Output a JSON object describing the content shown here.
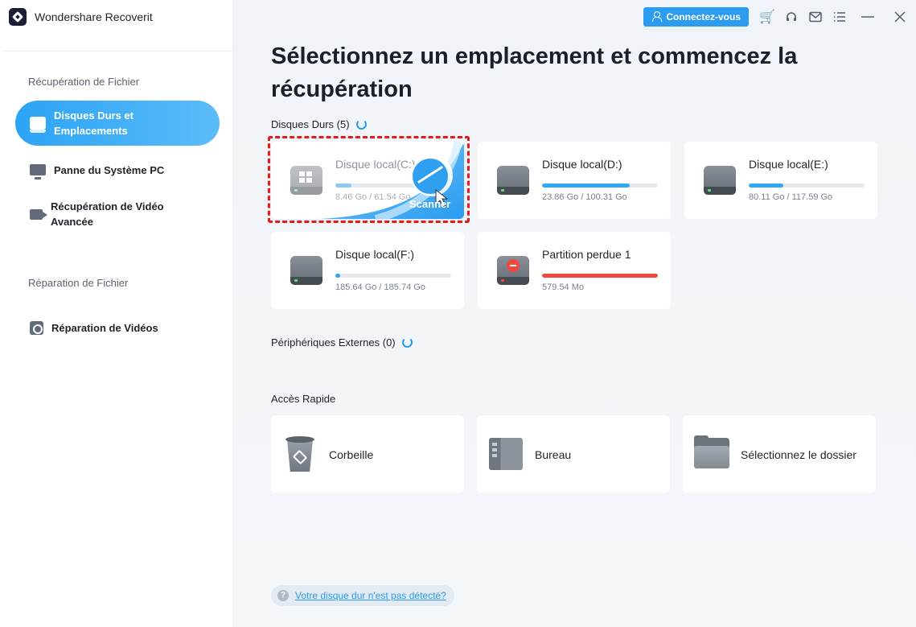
{
  "app": {
    "title": "Wondershare Recoverit"
  },
  "topbar": {
    "connect_label": "Connectez-vous",
    "icons": [
      "cart-icon",
      "headset-icon",
      "mail-icon",
      "menu-icon",
      "minimize-icon",
      "close-icon"
    ],
    "cart_color": "#ff7a1a"
  },
  "sidebar": {
    "section1": "Récupération de Fichier",
    "items": [
      {
        "label": "Disques Durs et Emplacements",
        "icon": "disk-icon",
        "active": true
      },
      {
        "label": "Panne du Système PC",
        "icon": "pc-icon",
        "active": false
      },
      {
        "label": "Récupération de Vidéo Avancée",
        "icon": "video-icon",
        "active": false
      }
    ],
    "section2": "Réparation de Fichier",
    "items2": [
      {
        "label": "Réparation de Vidéos",
        "icon": "video-repair-icon"
      }
    ]
  },
  "main": {
    "headline": "Sélectionnez un emplacement et commencez la récupération",
    "hard_drives_label": "Disques Durs (5)",
    "drives": [
      {
        "name": "Disque local(C:)",
        "size": "8.46 Go / 61.54 Go",
        "used_fraction": 0.14,
        "scan_label": "Scanner"
      },
      {
        "name": "Disque local(D:)",
        "size": "23.86 Go / 100.31 Go",
        "used_fraction": 0.76
      },
      {
        "name": "Disque local(E:)",
        "size": "80.11 Go / 117.59 Go",
        "used_fraction": 0.3
      },
      {
        "name": "Disque local(F:)",
        "size": "185.64 Go / 185.74 Go",
        "used_fraction": 0.04
      },
      {
        "name": "Partition perdue 1",
        "size": "579.54 Mo",
        "used_fraction": 1.0,
        "bar_color": "#f2473c"
      }
    ],
    "external_label": "Périphériques Externes (0)",
    "quick_access_label": "Accès Rapide",
    "quick": [
      {
        "label": "Corbeille",
        "icon": "recycle-bin-icon"
      },
      {
        "label": "Bureau",
        "icon": "desktop-icon"
      },
      {
        "label": "Sélectionnez le dossier",
        "icon": "folder-icon"
      }
    ],
    "help_link": "Votre disque dur n'est pas détecté?"
  },
  "colors": {
    "accent": "#2c9cf0",
    "highlight_border": "#e01c1c"
  }
}
